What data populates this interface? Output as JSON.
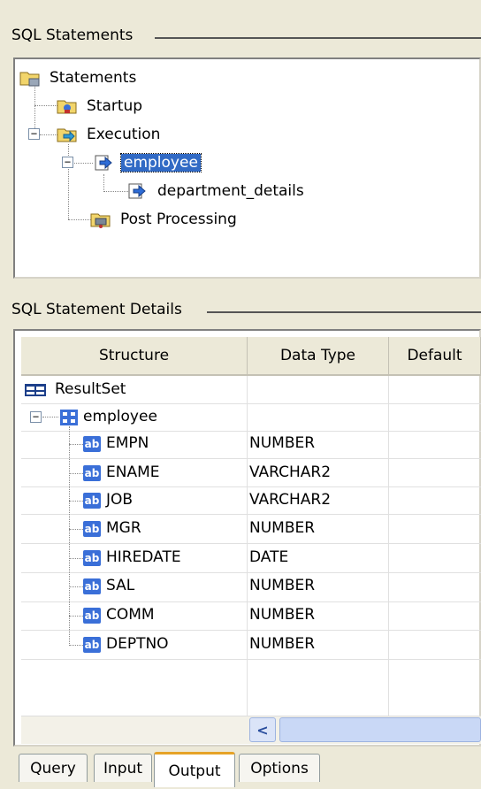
{
  "sql_statements": {
    "title": "SQL Statements",
    "tree": {
      "root": "Statements",
      "startup": "Startup",
      "execution": "Execution",
      "employee": "employee",
      "department_details": "department_details",
      "post_processing": "Post Processing"
    }
  },
  "details": {
    "title": "SQL Statement Details",
    "columns": [
      "Structure",
      "Data Type",
      "Default"
    ],
    "resultset_label": "ResultSet",
    "employee_label": "employee",
    "fields": [
      {
        "name": "EMPN",
        "type": "NUMBER"
      },
      {
        "name": "ENAME",
        "type": "VARCHAR2"
      },
      {
        "name": "JOB",
        "type": "VARCHAR2"
      },
      {
        "name": "MGR",
        "type": "NUMBER"
      },
      {
        "name": "HIREDATE",
        "type": "DATE"
      },
      {
        "name": "SAL",
        "type": "NUMBER"
      },
      {
        "name": "COMM",
        "type": "NUMBER"
      },
      {
        "name": "DEPTNO",
        "type": "NUMBER"
      }
    ],
    "field_icon_text": "ab",
    "scroll_left_glyph": "<"
  },
  "tabs": [
    {
      "label": "Query"
    },
    {
      "label": "Input"
    },
    {
      "label": "Output",
      "active": true
    },
    {
      "label": "Options"
    }
  ],
  "colors": {
    "selection": "#316ac5",
    "active_tab_accent": "#e6a327",
    "field_icon": "#3a6fd8"
  }
}
